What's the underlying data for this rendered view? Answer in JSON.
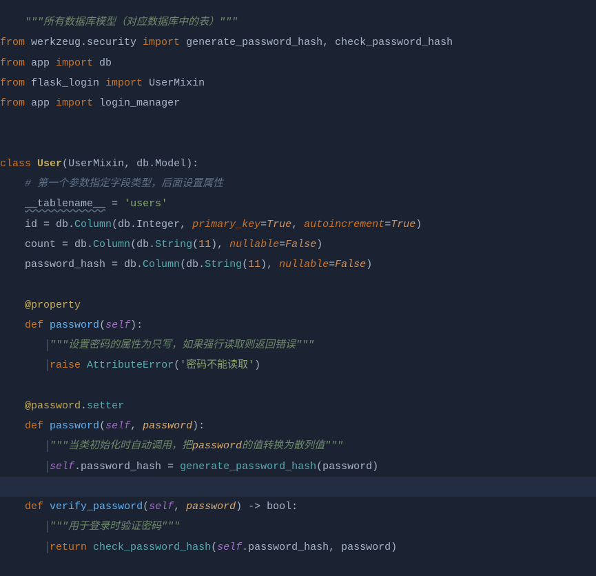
{
  "code": {
    "l1": {
      "ind": "    ",
      "doc": "\"\"\"所有数据库模型（对应数据库中的表）\"\"\""
    },
    "l2": {
      "from": "from",
      "mod": " werkzeug.security ",
      "imp": "import",
      "names": " generate_password_hash, check_password_hash"
    },
    "l3": {
      "from": "from",
      "mod": " app ",
      "imp": "import",
      "names": " db"
    },
    "l4": {
      "from": "from",
      "mod": " flask_login ",
      "imp": "import",
      "names": " UserMixin"
    },
    "l5": {
      "from": "from",
      "mod": " app ",
      "imp": "import",
      "names": " login_manager"
    },
    "l6": "",
    "l7": "",
    "l8": {
      "kw": "class",
      "sp": " ",
      "name": "User",
      "open": "(",
      "base": "UserMixin, db.Model",
      "close": "):"
    },
    "l9": {
      "ind": "    ",
      "c": "# 第一个参数指定字段类型，后面设置属性"
    },
    "l10": {
      "ind": "    ",
      "tn": "__tablename__",
      "eq": " = ",
      "str": "'users'"
    },
    "l11": {
      "ind": "    ",
      "lhs": "id = db.",
      "fn1": "Column",
      "p1": "(db.Integer, ",
      "kw1": "primary_key",
      "eq1": "=",
      "c1": "True",
      "cm1": ", ",
      "kw2": "autoincrement",
      "eq2": "=",
      "c2": "True",
      "pc": ")"
    },
    "l12": {
      "ind": "    ",
      "lhs": "count = db.",
      "fn1": "Column",
      "p1": "(db.",
      "fn2": "String",
      "p2": "(",
      "num": "11",
      "p3": "), ",
      "kw1": "nullable",
      "eq1": "=",
      "c1": "False",
      "pc": ")"
    },
    "l13": {
      "ind": "    ",
      "lhs": "password_hash = db.",
      "fn1": "Column",
      "p1": "(db.",
      "fn2": "String",
      "p2": "(",
      "num": "11",
      "p3": "), ",
      "kw1": "nullable",
      "eq1": "=",
      "c1": "False",
      "pc": ")"
    },
    "l14": "",
    "l15": {
      "ind": "    ",
      "dec": "@property"
    },
    "l16": {
      "ind": "    ",
      "kw": "def",
      "sp": " ",
      "fn": "password",
      "open": "(",
      "self": "self",
      "close": "):"
    },
    "l17": {
      "ind": "        ",
      "doc": "\"\"\"设置密码的属性为只写，如果强行读取则返回错误\"\"\""
    },
    "l18": {
      "ind": "        ",
      "kw": "raise",
      "sp": " ",
      "exc": "AttributeError",
      "open": "(",
      "str": "'密码不能读取'",
      "close": ")"
    },
    "l19": "",
    "l20": {
      "ind": "    ",
      "at": "@",
      "decp": "password",
      "dot": ".",
      "dect": "setter"
    },
    "l21": {
      "ind": "    ",
      "kw": "def",
      "sp": " ",
      "fn": "password",
      "open": "(",
      "self": "self",
      "cm": ", ",
      "p1": "password",
      "close": "):"
    },
    "l22": {
      "ind": "        ",
      "d1": "\"\"\"当类初始化时自动调用，把",
      "d2": "password",
      "d3": "的值转换为散列值\"\"\""
    },
    "l23": {
      "ind": "        ",
      "self": "self",
      "dot": ".password_hash = ",
      "fn": "generate_password_hash",
      "open": "(",
      "arg": "password",
      "close": ")"
    },
    "l24": "",
    "l25": {
      "ind": "    ",
      "kw": "def",
      "sp": " ",
      "fn": "verify_password",
      "open": "(",
      "self": "self",
      "cm": ", ",
      "p1": "password",
      "close": ") -> ",
      "ret": "bool",
      "colon": ":"
    },
    "l26": {
      "ind": "        ",
      "doc": "\"\"\"用于登录时验证密码\"\"\""
    },
    "l27": {
      "ind": "        ",
      "kw": "return",
      "sp": " ",
      "fn": "check_password_hash",
      "open": "(",
      "self": "self",
      "dot": ".password_hash, password",
      "close": ")"
    }
  }
}
